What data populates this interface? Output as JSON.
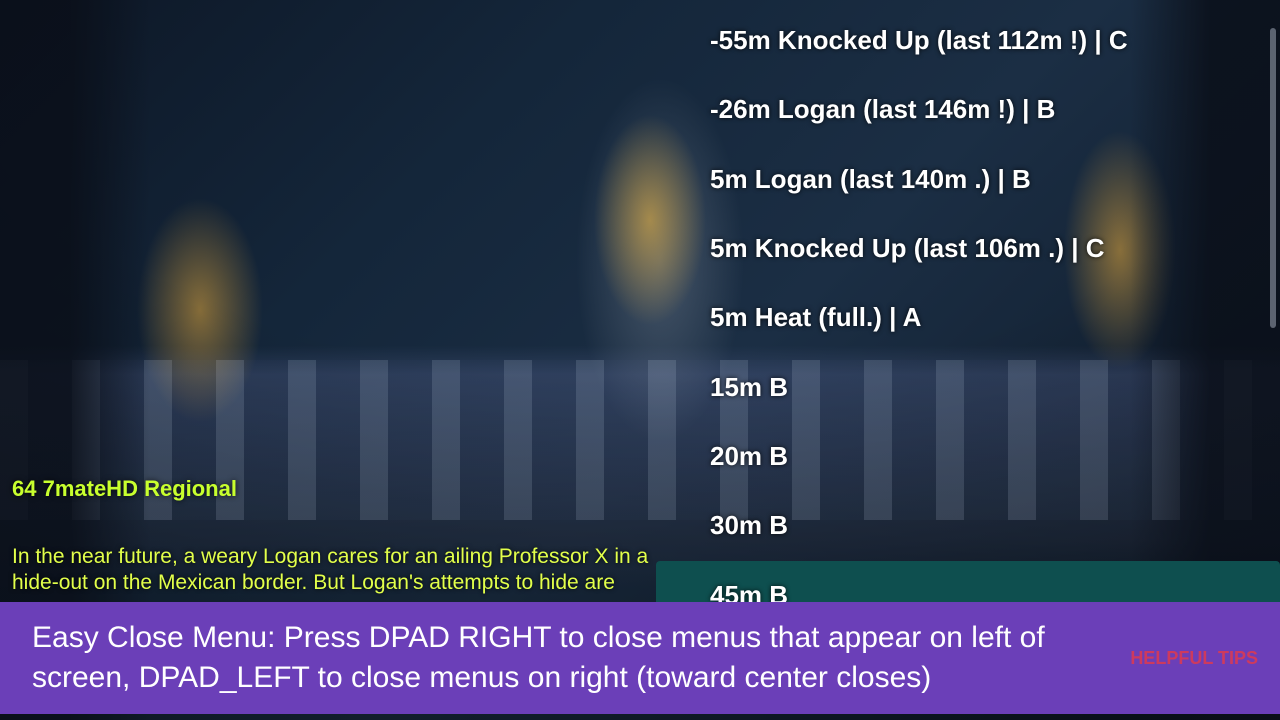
{
  "channel": {
    "label": "64 7mateHD Regional"
  },
  "synopsis": {
    "text": "In the near future, a weary Logan cares for an ailing Professor X in a hide-out on the Mexican border. But Logan's attempts to hide are"
  },
  "menu": {
    "items": [
      {
        "label": "-55m Knocked Up (last 112m !) | C",
        "selected": false
      },
      {
        "label": "-26m Logan (last 146m !) | B",
        "selected": false
      },
      {
        "label": "5m Logan (last 140m .) | B",
        "selected": false
      },
      {
        "label": "5m Knocked Up (last 106m .) | C",
        "selected": false
      },
      {
        "label": "5m Heat (full.) | A",
        "selected": false
      },
      {
        "label": "15m B",
        "selected": false
      },
      {
        "label": "20m B",
        "selected": false
      },
      {
        "label": "30m B",
        "selected": false
      },
      {
        "label": "45m B",
        "selected": true
      }
    ]
  },
  "tips": {
    "text": "Easy Close Menu: Press DPAD RIGHT to close menus that appear on left of screen, DPAD_LEFT to close menus on right (toward center closes)",
    "label": "HELPFUL TIPS"
  }
}
